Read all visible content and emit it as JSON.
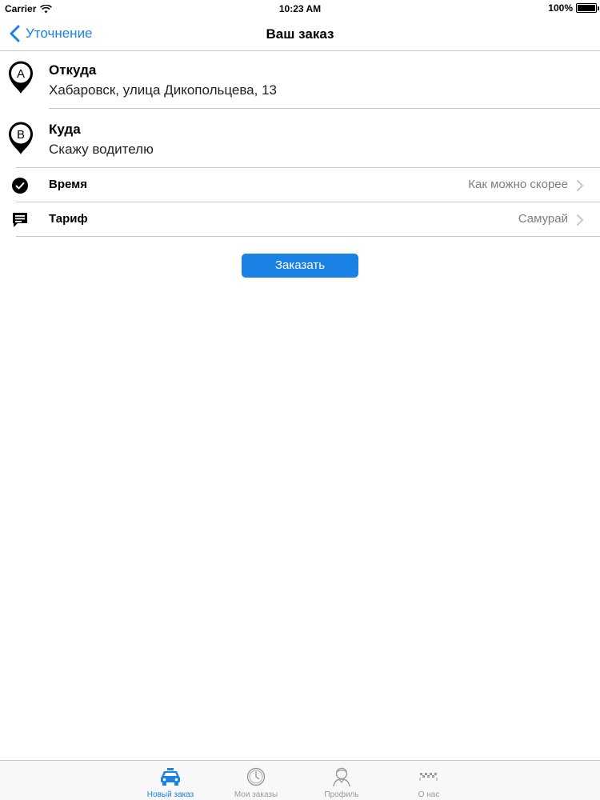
{
  "status_bar": {
    "carrier": "Carrier",
    "time": "10:23 AM",
    "battery": "100%",
    "battery_level": 1.0,
    "icons": [
      "wifi-icon",
      "battery-icon"
    ]
  },
  "nav_bar": {
    "back_label": "Уточнение",
    "title": "Ваш заказ"
  },
  "route": {
    "from": {
      "marker": "A",
      "label": "Откуда",
      "value": "Хабаровск, улица Дикопольцева, 13"
    },
    "to": {
      "marker": "B",
      "label": "Куда",
      "value": "Скажу водителю"
    }
  },
  "settings": [
    {
      "label": "Время",
      "value": "Как можно скорее",
      "icon": "clock-icon"
    },
    {
      "label": "Тариф",
      "value": "Самурай",
      "icon": "chat-bubble-icon"
    }
  ],
  "order_button": {
    "label": "Заказать"
  },
  "tab_bar": {
    "tabs": [
      {
        "label": "Новый заказ",
        "icon": "taxi-icon",
        "active": true
      },
      {
        "label": "Мои заказы",
        "icon": "clock-icon",
        "active": false
      },
      {
        "label": "Профиль",
        "icon": "person-icon",
        "active": false
      },
      {
        "label": "О нас",
        "icon": "taxi-checker-icon",
        "active": false
      }
    ]
  },
  "colors": {
    "accent": "#1a82e4",
    "separator": "#c8c7cc",
    "secondary_text": "#7d7d7d",
    "tab_inactive": "#9b9b9b"
  }
}
